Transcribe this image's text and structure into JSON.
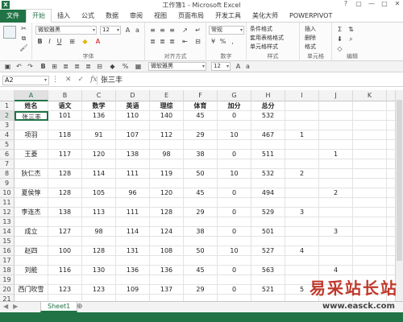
{
  "window": {
    "title": "工作簿1 - Microsoft Excel",
    "controls": [
      "?",
      "▢",
      "—",
      "□",
      "✕"
    ]
  },
  "tabs": [
    "文件",
    "开始",
    "插入",
    "公式",
    "数据",
    "审阅",
    "视图",
    "页面布局",
    "开发工具",
    "美化大师",
    "POWERPIVOT"
  ],
  "ribbon": {
    "font_name": "微软雅黑",
    "font_size": "12",
    "number_format": "常规",
    "groups": [
      "字体",
      "对齐方式",
      "数字",
      "样式",
      "单元格",
      "编辑"
    ],
    "style_items": [
      "条件格式",
      "套用表格格式",
      "单元格样式"
    ],
    "cell_items": [
      "插入",
      "删除",
      "格式"
    ],
    "quick_font": "微软雅黑",
    "quick_size": "12"
  },
  "formula_bar": {
    "name_box": "A2",
    "content": "张三丰"
  },
  "columns": [
    "A",
    "B",
    "C",
    "D",
    "E",
    "F",
    "G",
    "H",
    "I",
    "J",
    "K",
    "L"
  ],
  "rows": [
    {
      "num": "1",
      "cells": [
        "姓名",
        "语文",
        "数学",
        "英语",
        "理综",
        "体育",
        "加分",
        "总分",
        "",
        "",
        "",
        ""
      ]
    },
    {
      "num": "2",
      "cells": [
        "张三丰",
        "101",
        "136",
        "110",
        "140",
        "45",
        "0",
        "532",
        "",
        "",
        "",
        ""
      ]
    },
    {
      "num": "3",
      "cells": [
        "",
        "",
        "",
        "",
        "",
        "",
        "",
        "",
        "",
        "",
        "",
        ""
      ]
    },
    {
      "num": "4",
      "cells": [
        "项羽",
        "118",
        "91",
        "107",
        "112",
        "29",
        "10",
        "467",
        "1",
        "",
        "",
        ""
      ]
    },
    {
      "num": "5",
      "cells": [
        "",
        "",
        "",
        "",
        "",
        "",
        "",
        "",
        "",
        "",
        "",
        ""
      ]
    },
    {
      "num": "6",
      "cells": [
        "王菱",
        "117",
        "120",
        "138",
        "98",
        "38",
        "0",
        "511",
        "",
        "1",
        "",
        ""
      ]
    },
    {
      "num": "7",
      "cells": [
        "",
        "",
        "",
        "",
        "",
        "",
        "",
        "",
        "",
        "",
        "",
        ""
      ]
    },
    {
      "num": "8",
      "cells": [
        "狄仁杰",
        "128",
        "114",
        "111",
        "119",
        "50",
        "10",
        "532",
        "2",
        "",
        "",
        ""
      ]
    },
    {
      "num": "9",
      "cells": [
        "",
        "",
        "",
        "",
        "",
        "",
        "",
        "",
        "",
        "",
        "",
        ""
      ]
    },
    {
      "num": "10",
      "cells": [
        "夏侯惇",
        "128",
        "105",
        "96",
        "120",
        "45",
        "0",
        "494",
        "",
        "2",
        "",
        ""
      ]
    },
    {
      "num": "11",
      "cells": [
        "",
        "",
        "",
        "",
        "",
        "",
        "",
        "",
        "",
        "",
        "",
        ""
      ]
    },
    {
      "num": "12",
      "cells": [
        "李连杰",
        "138",
        "113",
        "111",
        "128",
        "29",
        "0",
        "529",
        "3",
        "",
        "",
        ""
      ]
    },
    {
      "num": "13",
      "cells": [
        "",
        "",
        "",
        "",
        "",
        "",
        "",
        "",
        "",
        "",
        "",
        ""
      ]
    },
    {
      "num": "14",
      "cells": [
        "成立",
        "127",
        "98",
        "114",
        "124",
        "38",
        "0",
        "501",
        "",
        "3",
        "",
        ""
      ]
    },
    {
      "num": "15",
      "cells": [
        "",
        "",
        "",
        "",
        "",
        "",
        "",
        "",
        "",
        "",
        "",
        ""
      ]
    },
    {
      "num": "16",
      "cells": [
        "赵四",
        "100",
        "128",
        "131",
        "108",
        "50",
        "10",
        "527",
        "4",
        "",
        "",
        ""
      ]
    },
    {
      "num": "17",
      "cells": [
        "",
        "",
        "",
        "",
        "",
        "",
        "",
        "",
        "",
        "",
        "",
        ""
      ]
    },
    {
      "num": "18",
      "cells": [
        "刘能",
        "116",
        "130",
        "136",
        "136",
        "45",
        "0",
        "563",
        "",
        "4",
        "",
        ""
      ]
    },
    {
      "num": "19",
      "cells": [
        "",
        "",
        "",
        "",
        "",
        "",
        "",
        "",
        "",
        "",
        "",
        ""
      ]
    },
    {
      "num": "20",
      "cells": [
        "西门吹雪",
        "123",
        "123",
        "109",
        "137",
        "29",
        "0",
        "521",
        "5",
        "",
        "",
        ""
      ]
    },
    {
      "num": "21",
      "cells": [
        "",
        "",
        "",
        "",
        "",
        "",
        "",
        "",
        "",
        "",
        "",
        ""
      ]
    }
  ],
  "sheet_tabs": [
    "Sheet1"
  ],
  "watermark": {
    "text": "易采站长站",
    "url": "www.easck.com"
  },
  "colors": {
    "accent": "#217346",
    "watermark": "#c0392b"
  }
}
